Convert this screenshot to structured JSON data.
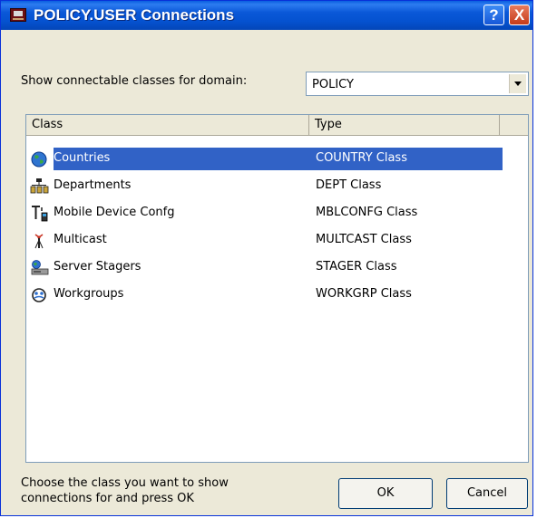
{
  "window": {
    "title": "POLICY.USER Connections",
    "help_symbol": "?",
    "close_symbol": "X"
  },
  "domain": {
    "label": "Show connectable classes for domain:",
    "value": "POLICY"
  },
  "list": {
    "columns": [
      "Class",
      "Type"
    ],
    "rows": [
      {
        "name": "Countries",
        "type": "COUNTRY Class",
        "icon": "globe-icon",
        "selected": true
      },
      {
        "name": "Departments",
        "type": "DEPT Class",
        "icon": "org-chart-icon",
        "selected": false
      },
      {
        "name": "Mobile Device Confg",
        "type": "MBLCONFG Class",
        "icon": "mobile-device-icon",
        "selected": false
      },
      {
        "name": "Multicast",
        "type": "MULTCAST Class",
        "icon": "antenna-icon",
        "selected": false
      },
      {
        "name": "Server Stagers",
        "type": "STAGER Class",
        "icon": "server-icon",
        "selected": false
      },
      {
        "name": "Workgroups",
        "type": "WORKGRP Class",
        "icon": "workgroup-icon",
        "selected": false
      }
    ]
  },
  "footer": {
    "hint_line1": "Choose the class you want to show",
    "hint_line2": "connections for and press OK",
    "ok_label": "OK",
    "cancel_label": "Cancel"
  },
  "colors": {
    "titlebar": "#0a58d8",
    "selection": "#3162c6",
    "dialog_bg": "#ece9d8"
  }
}
